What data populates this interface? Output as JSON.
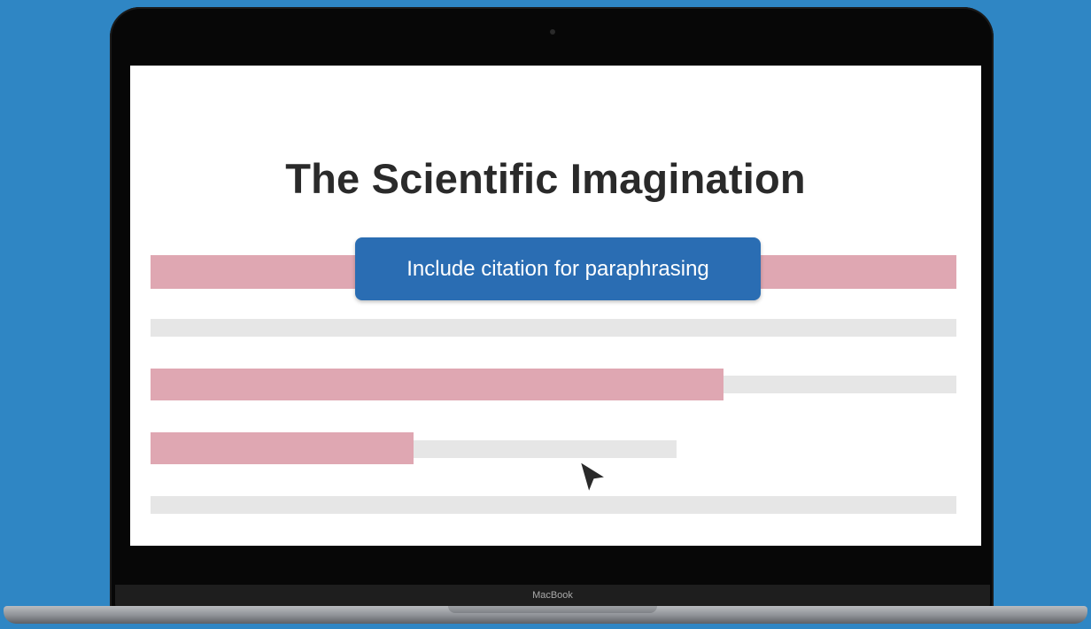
{
  "document": {
    "title": "The Scientific Imagination"
  },
  "tooltip": {
    "text": "Include citation for paraphrasing"
  },
  "device": {
    "brand_label": "MacBook"
  },
  "colors": {
    "background": "#2f86c4",
    "highlight": "#dfa7b2",
    "text_line": "#e6e6e6",
    "tooltip": "#2a6db3",
    "title": "#2a2a2a"
  },
  "icons": {
    "cursor": "mouse-pointer-arrow"
  }
}
